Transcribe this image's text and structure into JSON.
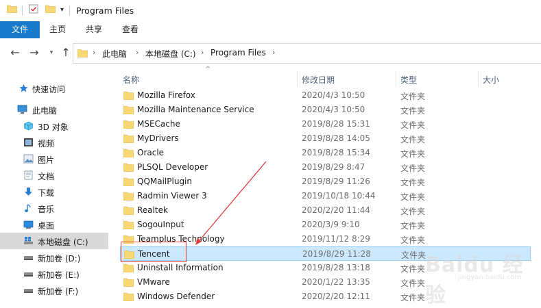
{
  "window": {
    "title": "Program Files"
  },
  "ribbon": {
    "tabs": [
      "文件",
      "主页",
      "共享",
      "查看"
    ]
  },
  "address": {
    "crumbs": [
      "此电脑",
      "本地磁盘 (C:)",
      "Program Files"
    ]
  },
  "sidebar": {
    "items": [
      {
        "label": "快速访问",
        "icon": "star-pin-icon"
      },
      {
        "label": "此电脑",
        "icon": "computer-icon"
      },
      {
        "label": "3D 对象",
        "icon": "cube-icon"
      },
      {
        "label": "视频",
        "icon": "video-icon"
      },
      {
        "label": "图片",
        "icon": "picture-icon"
      },
      {
        "label": "文档",
        "icon": "document-icon"
      },
      {
        "label": "下载",
        "icon": "download-icon"
      },
      {
        "label": "音乐",
        "icon": "music-icon"
      },
      {
        "label": "桌面",
        "icon": "desktop-icon"
      },
      {
        "label": "本地磁盘 (C:)",
        "icon": "windows-drive-icon",
        "selected": true
      },
      {
        "label": "新加卷 (D:)",
        "icon": "drive-icon"
      },
      {
        "label": "新加卷 (E:)",
        "icon": "drive-icon"
      },
      {
        "label": "新加卷 (F:)",
        "icon": "drive-icon"
      }
    ]
  },
  "columns": {
    "name": "名称",
    "date": "修改日期",
    "type": "类型",
    "size": "大小"
  },
  "files": [
    {
      "name": "Mozilla Firefox",
      "date": "2020/4/3 10:50",
      "type": "文件夹"
    },
    {
      "name": "Mozilla Maintenance Service",
      "date": "2020/4/3 10:50",
      "type": "文件夹"
    },
    {
      "name": "MSECache",
      "date": "2019/8/28 15:31",
      "type": "文件夹"
    },
    {
      "name": "MyDrivers",
      "date": "2019/8/28 14:05",
      "type": "文件夹"
    },
    {
      "name": "Oracle",
      "date": "2019/8/28 15:34",
      "type": "文件夹"
    },
    {
      "name": "PLSQL Developer",
      "date": "2019/8/29 8:47",
      "type": "文件夹"
    },
    {
      "name": "QQMailPlugin",
      "date": "2019/8/29 11:26",
      "type": "文件夹"
    },
    {
      "name": "Radmin Viewer 3",
      "date": "2019/10/18 10:44",
      "type": "文件夹"
    },
    {
      "name": "Realtek",
      "date": "2020/2/20 11:44",
      "type": "文件夹"
    },
    {
      "name": "SogouInput",
      "date": "2020/3/9 9:10",
      "type": "文件夹"
    },
    {
      "name": "Teamplus Technology",
      "date": "2019/11/12 8:29",
      "type": "文件夹"
    },
    {
      "name": "Tencent",
      "date": "2019/8/29 11:28",
      "type": "文件夹",
      "selected": true
    },
    {
      "name": "Uninstall Information",
      "date": "2019/8/28 13:18",
      "type": "文件夹"
    },
    {
      "name": "VMware",
      "date": "2020/1/22 13:35",
      "type": "文件夹"
    },
    {
      "name": "Windows Defender",
      "date": "2020/2/20 12:11",
      "type": "文件夹"
    }
  ],
  "colors": {
    "accent": "#1979ca",
    "folder": "#f8d775",
    "selection": "#cce8ff",
    "annotation": "#e23b3b"
  },
  "watermark": {
    "text": "Baidu 经验",
    "sub": "jingyan.baidu.com"
  }
}
